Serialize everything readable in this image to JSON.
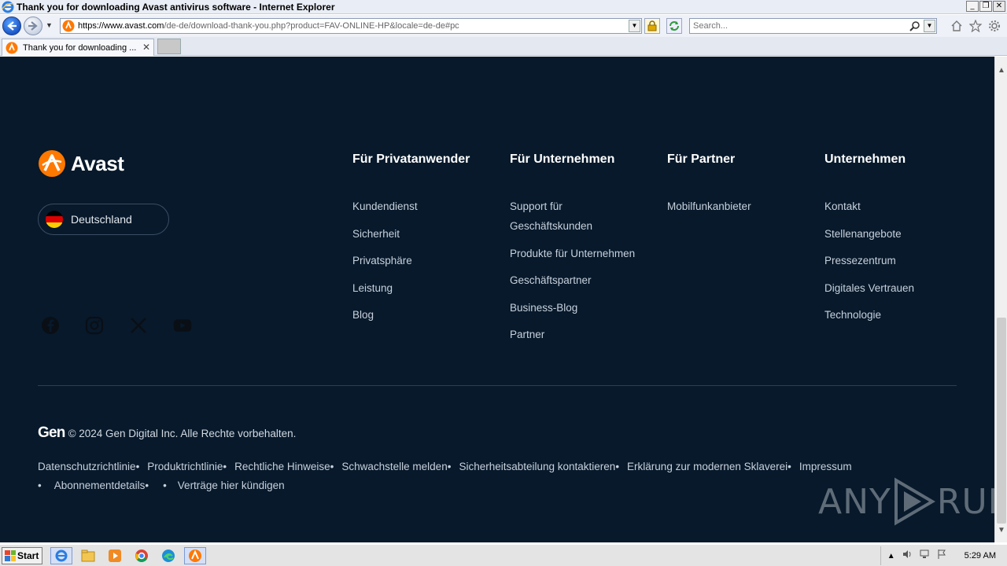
{
  "window": {
    "title": "Thank you for downloading Avast antivirus software - Internet Explorer",
    "controls": [
      "_",
      "❐",
      "✕"
    ]
  },
  "address": {
    "url_host": "https://www.avast.com",
    "url_path": "/de-de/download-thank-you.php?product=FAV-ONLINE-HP&locale=de-de#pc",
    "search_placeholder": "Search..."
  },
  "tabs": [
    {
      "label": "Thank you for downloading ...",
      "close": "✕"
    }
  ],
  "footer": {
    "brand": "Avast",
    "country": "Deutschland",
    "socials": [
      "facebook-icon",
      "instagram-icon",
      "x-icon",
      "youtube-icon"
    ],
    "columns": [
      {
        "heading": "Für Privatanwender",
        "links": [
          "Kundendienst",
          "Sicherheit",
          "Privatsphäre",
          "Leistung",
          "Blog"
        ]
      },
      {
        "heading": "Für Unternehmen",
        "links": [
          "Support für Geschäftskunden",
          "Produkte für Unternehmen",
          "Geschäftspartner",
          "Business-Blog",
          "Partner"
        ]
      },
      {
        "heading": "Für Partner",
        "links": [
          "Mobilfunkanbieter"
        ]
      },
      {
        "heading": "Unternehmen",
        "links": [
          "Kontakt",
          "Stellenangebote",
          "Pressezentrum",
          "Digitales Vertrauen",
          "Technologie"
        ]
      }
    ],
    "gen_logo": "Gen",
    "copyright": "© 2024 Gen Digital Inc. Alle Rechte vorbehalten.",
    "legal_links": [
      "Datenschutzrichtlinie",
      "Produktrichtlinie",
      "Rechtliche Hinweise",
      "Schwachstelle melden",
      "Sicherheitsabteilung kontaktieren",
      "Erklärung zur modernen Sklaverei",
      "Impressum",
      "",
      "Abonnementdetails",
      "",
      "Verträge hier kündigen"
    ],
    "bullet": "•"
  },
  "watermark": {
    "text_left": "ANY",
    "text_right": "RUN"
  },
  "taskbar": {
    "start_label": "Start",
    "apps": [
      "ie-icon",
      "explorer-icon",
      "media-player-icon",
      "chrome-icon",
      "edge-icon",
      "avast-icon"
    ],
    "clock": "5:29 AM"
  },
  "colors": {
    "page_bg": "#07192b",
    "avast_orange": "#ff7800",
    "link_text": "#c8d1dc"
  }
}
